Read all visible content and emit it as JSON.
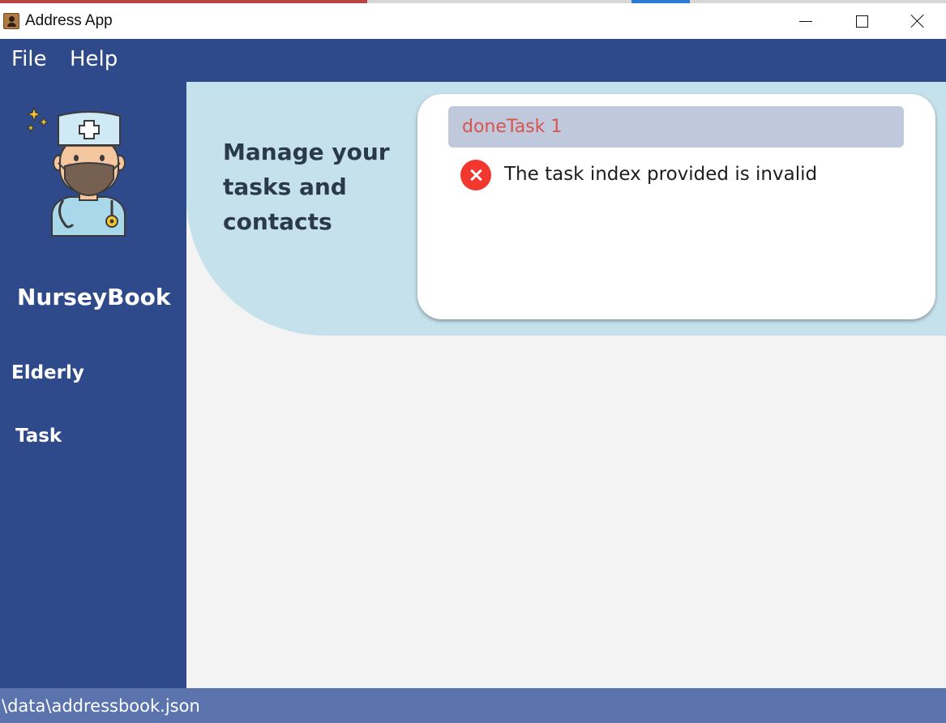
{
  "window": {
    "title": "Address App",
    "icon": "address-book-icon",
    "controls": [
      "minimize-icon",
      "maximize-icon",
      "close-icon"
    ]
  },
  "menu": {
    "file": "File",
    "help": "Help"
  },
  "sidebar": {
    "logo": "nurse-avatar-icon",
    "app_name": "NurseyBook",
    "items": [
      {
        "label": "Elderly"
      },
      {
        "label": "Task"
      }
    ]
  },
  "main": {
    "tagline": "Manage your tasks and contacts",
    "command": {
      "value": "doneTask 1"
    },
    "result": {
      "icon": "error-icon",
      "message": "The task index provided is invalid"
    }
  },
  "status": {
    "path": "\\data\\addressbook.json"
  },
  "colors": {
    "primary": "#2f4a8a",
    "banner": "#c5e1ec",
    "status_bar": "#5b74ae",
    "command_box": "#c0c9db",
    "error_text": "#d9544f",
    "error_icon": "#f1372e"
  }
}
